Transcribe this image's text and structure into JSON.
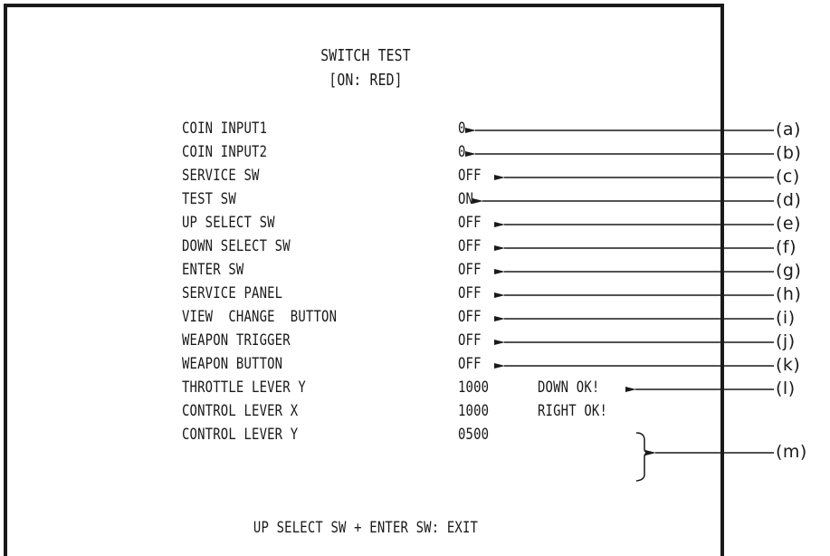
{
  "title": "SWITCH TEST",
  "subtitle": "[ON: RED]",
  "rows": [
    {
      "name": "COIN INPUT1",
      "value": "0",
      "extra": ""
    },
    {
      "name": "COIN INPUT2",
      "value": "0",
      "extra": ""
    },
    {
      "name": "SERVICE SW",
      "value": "OFF",
      "extra": ""
    },
    {
      "name": "TEST SW",
      "value": "ON",
      "extra": ""
    },
    {
      "name": "UP SELECT SW",
      "value": "OFF",
      "extra": ""
    },
    {
      "name": "DOWN SELECT SW",
      "value": "OFF",
      "extra": ""
    },
    {
      "name": "ENTER SW",
      "value": "OFF",
      "extra": ""
    },
    {
      "name": "SERVICE PANEL",
      "value": "OFF",
      "extra": ""
    },
    {
      "name": "VIEW  CHANGE  BUTTON",
      "value": "OFF",
      "extra": ""
    },
    {
      "name": "WEAPON TRIGGER",
      "value": "OFF",
      "extra": ""
    },
    {
      "name": "WEAPON BUTTON",
      "value": "OFF",
      "extra": ""
    },
    {
      "name": "THROTTLE LEVER Y",
      "value": "1000",
      "extra": "DOWN OK!"
    },
    {
      "name": "CONTROL LEVER X",
      "value": "1000",
      "extra": "RIGHT OK!"
    },
    {
      "name": "CONTROL LEVER Y",
      "value": "0500",
      "extra": ""
    }
  ],
  "footer": "UP SELECT SW + ENTER SW: EXIT",
  "callouts": [
    "(a)",
    "(b)",
    "(c)",
    "(d)",
    "(e)",
    "(f)",
    "(g)",
    "(h)",
    "(i)",
    "(j)",
    "(k)",
    "(l)",
    "(m)"
  ]
}
